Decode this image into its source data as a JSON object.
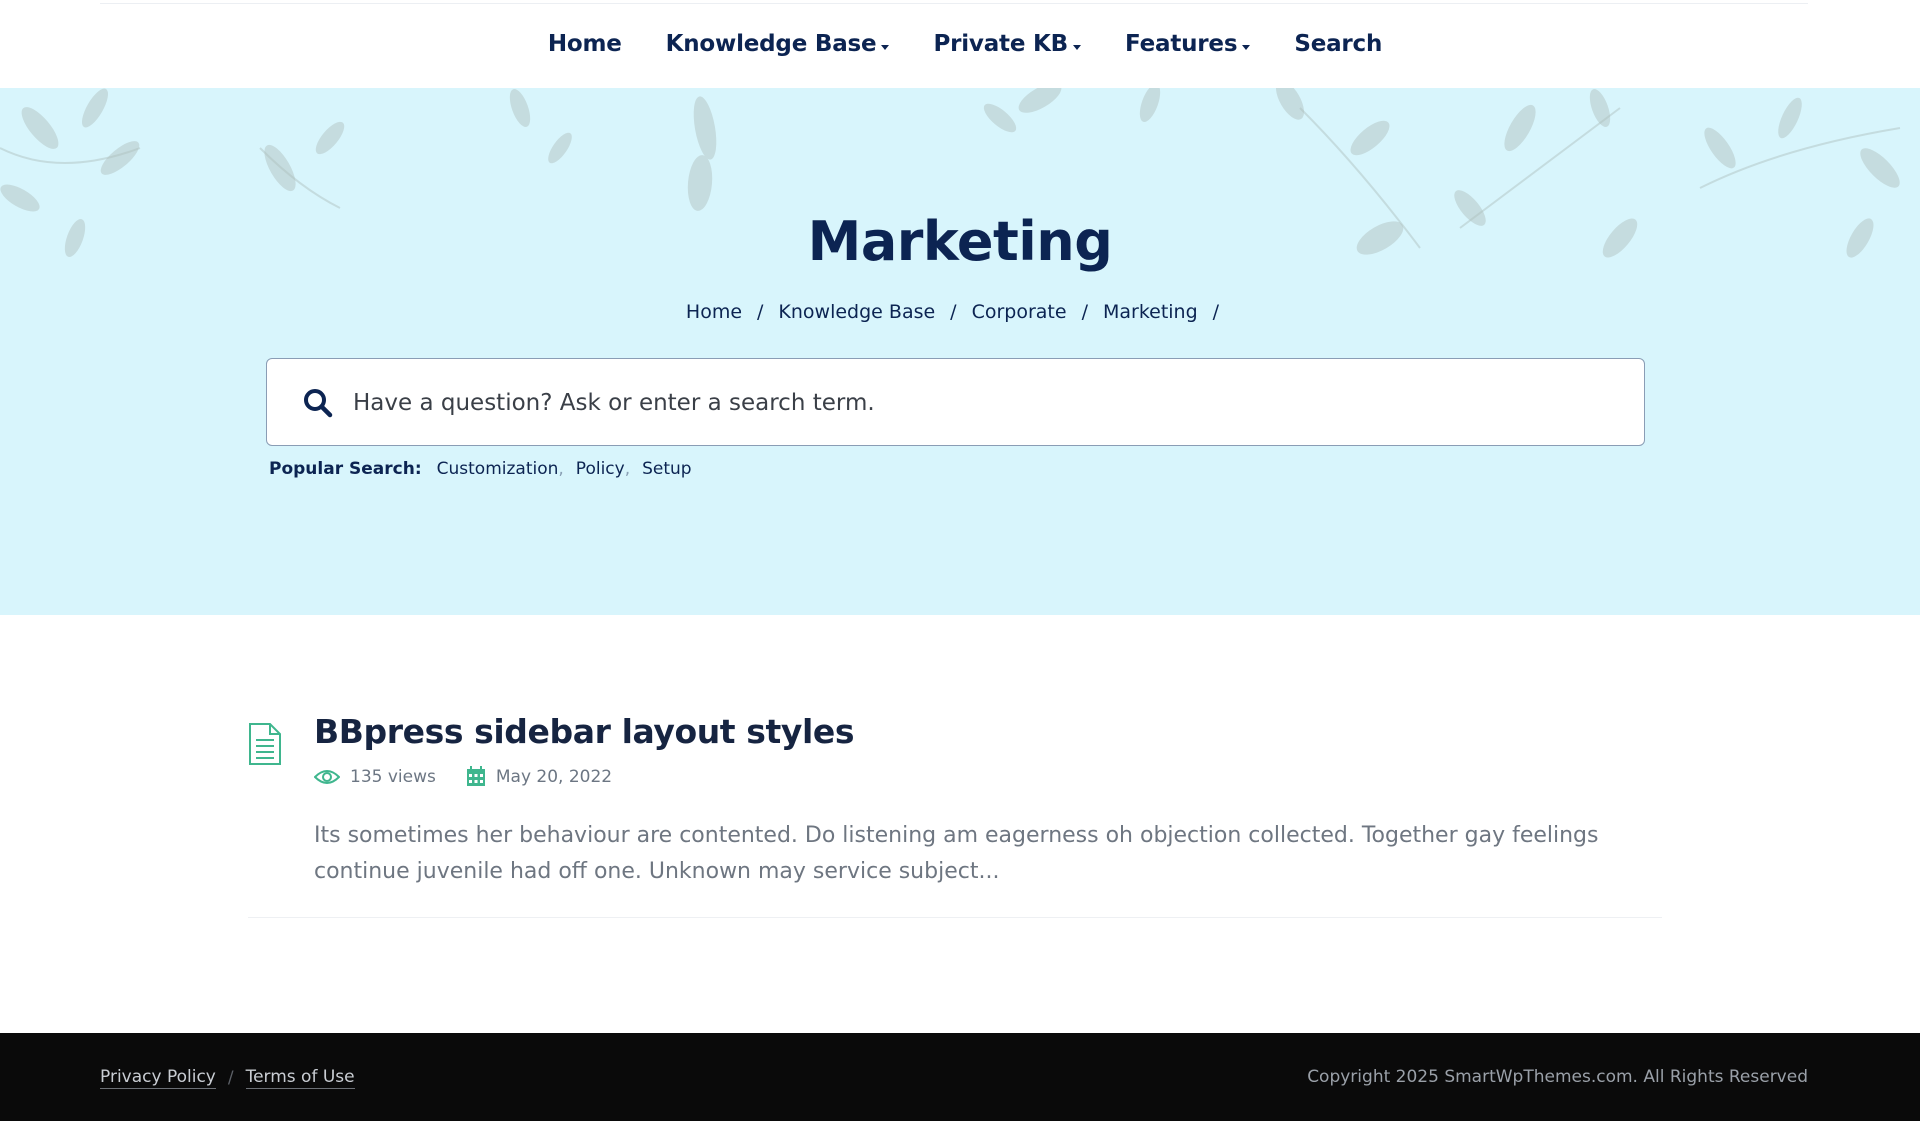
{
  "nav": {
    "items": [
      {
        "label": "Home",
        "has_dropdown": false
      },
      {
        "label": "Knowledge Base",
        "has_dropdown": true
      },
      {
        "label": "Private KB",
        "has_dropdown": true
      },
      {
        "label": "Features",
        "has_dropdown": true
      },
      {
        "label": "Search",
        "has_dropdown": false
      }
    ]
  },
  "hero": {
    "title": "Marketing",
    "breadcrumb": [
      "Home",
      "Knowledge Base",
      "Corporate",
      "Marketing"
    ],
    "breadcrumb_separator": "/",
    "background_color": "#d8f5fc"
  },
  "search": {
    "placeholder": "Have a question? Ask or enter a search term.",
    "value": "",
    "icon": "search-icon"
  },
  "popular_search": {
    "label": "Popular Search:",
    "terms": [
      "Customization",
      "Policy",
      "Setup"
    ]
  },
  "articles": [
    {
      "icon": "document-icon",
      "title": "BBpress sidebar layout styles",
      "views": "135 views",
      "date": "May 20, 2022",
      "excerpt": "Its sometimes her behaviour are contented. Do listening am eagerness oh objection collected. Together gay feelings continue juvenile had off one. Unknown may service subject..."
    }
  ],
  "footer": {
    "links": [
      "Privacy Policy",
      "Terms of Use"
    ],
    "separator": "/",
    "copyright": "Copyright 2025 SmartWpThemes.com. All Rights Reserved"
  },
  "colors": {
    "brand_navy": "#0c2452",
    "accent_green": "#3fb68e",
    "footer_bg": "#0a0a0a"
  }
}
